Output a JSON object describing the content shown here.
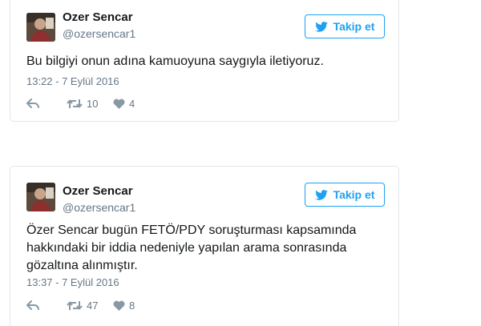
{
  "tweets": [
    {
      "name": "Ozer Sencar",
      "handle": "@ozersencar1",
      "follow_label": "Takip et",
      "text": "Bu bilgiyi onun adına kamuoyuna saygıyla iletiyoruz.",
      "timestamp": "13:22 - 7 Eylül 2016",
      "retweets": "10",
      "likes": "4"
    },
    {
      "name": "Ozer Sencar",
      "handle": "@ozersencar1",
      "follow_label": "Takip et",
      "text": "Özer Sencar bugün FETÖ/PDY soruşturması kapsamında hakkındaki bir iddia nedeniyle yapılan arama sonrasında gözaltına alınmıştır.",
      "timestamp": "13:37 - 7 Eylül 2016",
      "retweets": "47",
      "likes": "8"
    }
  ],
  "colors": {
    "accent": "#1da1f2",
    "secondary_text": "#657786",
    "icon": "#8899a6",
    "border": "#e1e8ed"
  },
  "icons": [
    "twitter-bird-icon",
    "reply-icon",
    "retweet-icon",
    "heart-icon"
  ]
}
